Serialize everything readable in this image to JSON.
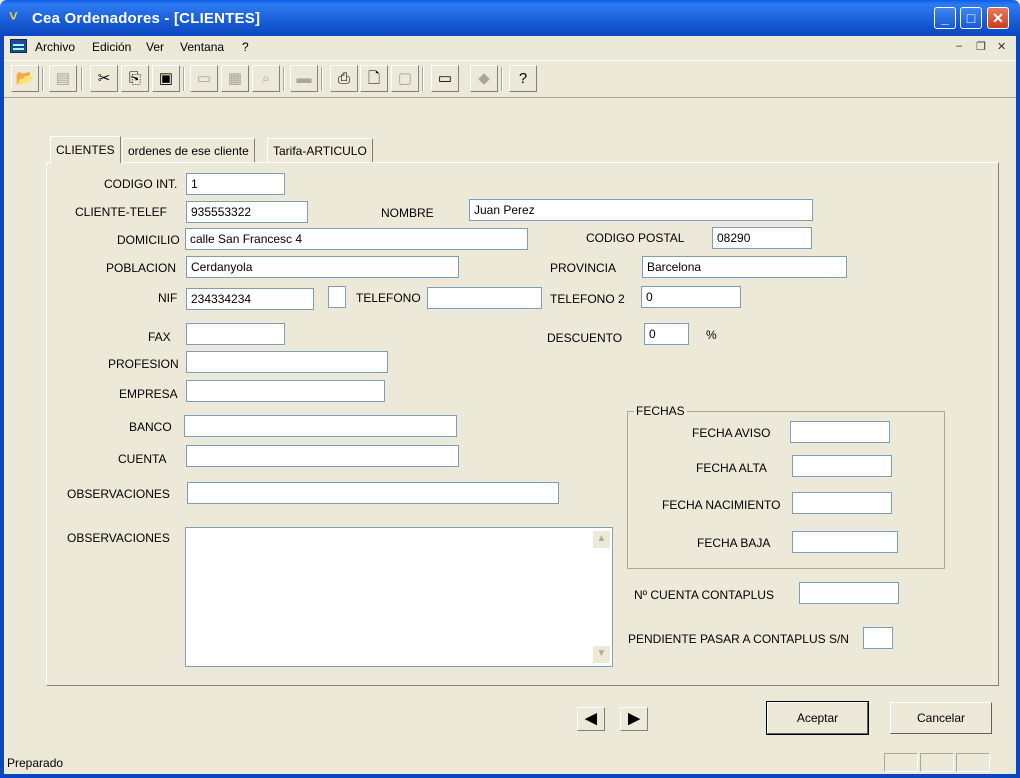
{
  "window": {
    "title": "Cea Ordenadores  - [CLIENTES]"
  },
  "menu": {
    "items": [
      "Archivo",
      "Edición",
      "Ver",
      "Ventana",
      "?"
    ]
  },
  "toolbar_icons": [
    "open-folder-icon",
    "edit-icon",
    "cut-icon",
    "copy-icon",
    "paste-icon",
    "window-icon",
    "calendar-icon",
    "zoom-icon",
    "scanner-icon",
    "print-icon",
    "print-preview-icon",
    "document-icon",
    "monitor-icon",
    "eraser-icon",
    "help-icon"
  ],
  "tabs": [
    "CLIENTES",
    "ordenes de ese cliente",
    "Tarifa-ARTICULO"
  ],
  "labels": {
    "codigo_int": "CODIGO INT.",
    "cliente_telef": "CLIENTE-TELEF",
    "nombre": "NOMBRE",
    "domicilio": "DOMICILIO",
    "codigo_postal": "CODIGO POSTAL",
    "poblacion": "POBLACION",
    "provincia": "PROVINCIA",
    "nif": "NIF",
    "telefono": "TELEFONO",
    "telefono2": "TELEFONO 2",
    "fax": "FAX",
    "descuento": "DESCUENTO",
    "percent": "%",
    "profesion": "PROFESION",
    "empresa": "EMPRESA",
    "banco": "BANCO",
    "cuenta": "CUENTA",
    "observaciones1": "OBSERVACIONES",
    "observaciones2": "OBSERVACIONES",
    "fechas": "FECHAS",
    "fecha_aviso": "FECHA AVISO",
    "fecha_alta": "FECHA ALTA",
    "fecha_nacimiento": "FECHA NACIMIENTO",
    "fecha_baja": "FECHA BAJA",
    "cuenta_contaplus": "Nº CUENTA CONTAPLUS",
    "pendiente_contaplus": "PENDIENTE PASAR A CONTAPLUS S/N"
  },
  "values": {
    "codigo_int": "1",
    "cliente_telef": "935553322",
    "nombre": "Juan Perez",
    "domicilio": "calle San Francesc 4",
    "codigo_postal": "08290",
    "poblacion": "Cerdanyola",
    "provincia": "Barcelona",
    "nif": "234334234",
    "nif_extra": "",
    "telefono": "",
    "telefono2": "0",
    "fax": "",
    "descuento": "0",
    "profesion": "",
    "empresa": "",
    "banco": "",
    "cuenta": "",
    "observaciones1": "",
    "observaciones2": "",
    "fecha_aviso": "",
    "fecha_alta": "",
    "fecha_nacimiento": "",
    "fecha_baja": "",
    "cuenta_contaplus": "",
    "pendiente_contaplus": ""
  },
  "nav": {
    "prev": "◀",
    "next": "▶"
  },
  "buttons": {
    "aceptar": "Aceptar",
    "cancelar": "Cancelar"
  },
  "status": {
    "text": "Preparado"
  }
}
